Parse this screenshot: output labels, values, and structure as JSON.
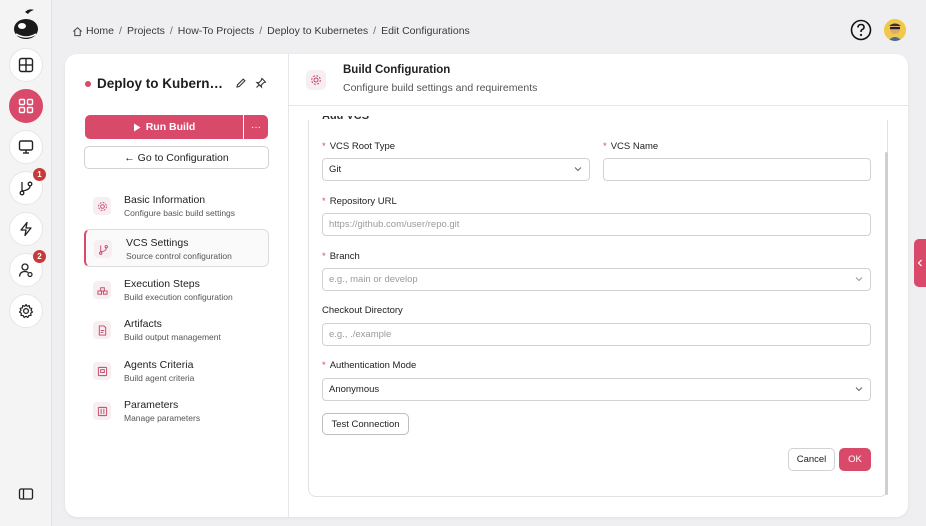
{
  "breadcrumb": [
    "Home",
    "Projects",
    "How-To Projects",
    "Deploy to Kubernetes",
    "Edit Configurations"
  ],
  "rail": {
    "badges": {
      "vcs": "1",
      "users": "2"
    }
  },
  "project": {
    "title": "Deploy to Kubernetes"
  },
  "actions": {
    "run_build": "Run Build",
    "more": "···",
    "goto_config": "← Go to Configuration"
  },
  "nav": [
    {
      "title": "Basic Information",
      "subtitle": "Configure basic build settings"
    },
    {
      "title": "VCS Settings",
      "subtitle": "Source control configuration"
    },
    {
      "title": "Execution Steps",
      "subtitle": "Build execution configuration"
    },
    {
      "title": "Artifacts",
      "subtitle": "Build output management"
    },
    {
      "title": "Agents Criteria",
      "subtitle": "Build agent criteria"
    },
    {
      "title": "Parameters",
      "subtitle": "Manage parameters"
    }
  ],
  "header": {
    "title": "Build Configuration",
    "subtitle": "Configure build settings and requirements"
  },
  "form": {
    "section_title": "Add VCS",
    "vcs_root_type": {
      "label": "VCS Root Type",
      "value": "Git"
    },
    "vcs_name": {
      "label": "VCS Name",
      "value": ""
    },
    "repo_url": {
      "label": "Repository URL",
      "placeholder": "https://github.com/user/repo.git"
    },
    "branch": {
      "label": "Branch",
      "placeholder": "e.g., main or develop"
    },
    "checkout_dir": {
      "label": "Checkout Directory",
      "placeholder": "e.g., ./example"
    },
    "auth_mode": {
      "label": "Authentication Mode",
      "value": "Anonymous"
    },
    "test_connection": "Test Connection",
    "cancel": "Cancel",
    "ok": "OK"
  },
  "colors": {
    "accent": "#d94a6a",
    "badge": "#c63a3a"
  }
}
